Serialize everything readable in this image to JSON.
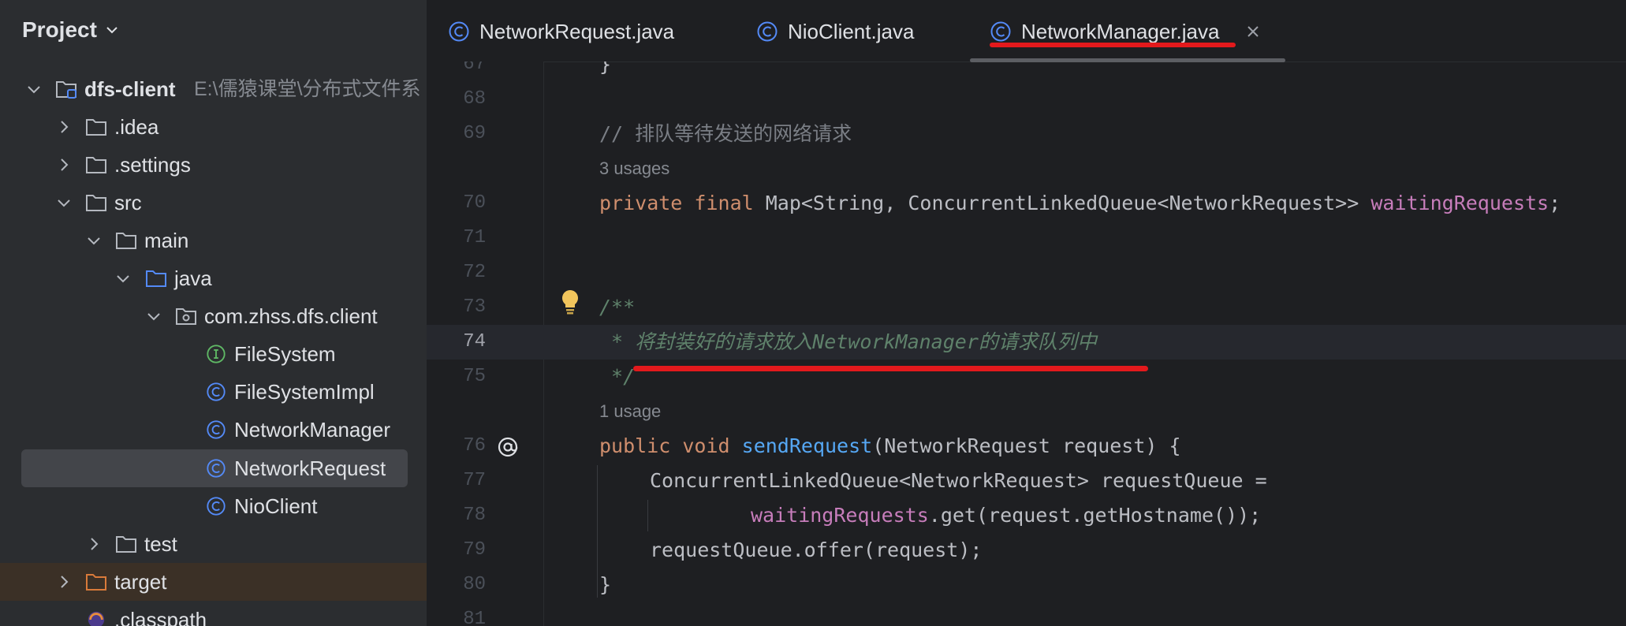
{
  "sidebar": {
    "title": "Project",
    "tree": [
      {
        "label": "dfs-client",
        "path": "E:\\儒猿课堂\\分布式文件系",
        "icon": "module-folder-icon",
        "expanded": true
      },
      {
        "label": ".idea",
        "icon": "folder-icon",
        "expanded": false
      },
      {
        "label": ".settings",
        "icon": "folder-icon",
        "expanded": false
      },
      {
        "label": "src",
        "icon": "folder-icon",
        "expanded": true
      },
      {
        "label": "main",
        "icon": "folder-icon",
        "expanded": true
      },
      {
        "label": "java",
        "icon": "source-folder-icon",
        "expanded": true
      },
      {
        "label": "com.zhss.dfs.client",
        "icon": "package-icon",
        "expanded": true
      },
      {
        "label": "FileSystem",
        "icon": "interface-icon"
      },
      {
        "label": "FileSystemImpl",
        "icon": "class-icon"
      },
      {
        "label": "NetworkManager",
        "icon": "class-icon"
      },
      {
        "label": "NetworkRequest",
        "icon": "class-icon",
        "selected": true
      },
      {
        "label": "NioClient",
        "icon": "class-icon"
      },
      {
        "label": "test",
        "icon": "folder-icon",
        "expanded": false
      },
      {
        "label": "target",
        "icon": "excluded-folder-icon",
        "expanded": false
      },
      {
        "label": ".classpath",
        "icon": "eclipse-file-icon"
      }
    ]
  },
  "tabs": [
    {
      "label": "NetworkRequest.java",
      "icon": "class-icon",
      "active": false
    },
    {
      "label": "NioClient.java",
      "icon": "class-icon",
      "active": false
    },
    {
      "label": "NetworkManager.java",
      "icon": "class-icon",
      "active": true
    }
  ],
  "editor": {
    "current_line": "74",
    "lines": [
      {
        "num": "67",
        "text": "}"
      },
      {
        "num": "68",
        "text": ""
      },
      {
        "num": "69",
        "text": "// 排队等待发送的网络请求"
      },
      {
        "hint": "3 usages"
      },
      {
        "num": "70",
        "kw": "private final",
        "plain1": " Map<String, ConcurrentLinkedQueue<NetworkRequest>> ",
        "field": "waitingRequests",
        "plain2": ";"
      },
      {
        "num": "71",
        "text": ""
      },
      {
        "num": "72",
        "text": ""
      },
      {
        "num": "73",
        "text": "/**"
      },
      {
        "num": "74",
        "text": " * 将封装好的请求放入NetworkManager的请求队列中"
      },
      {
        "num": "75",
        "text": " */"
      },
      {
        "hint": "1 usage"
      },
      {
        "num": "76",
        "kw": "public void",
        "fn": "sendRequest",
        "plain": "(NetworkRequest request) {"
      },
      {
        "num": "77",
        "text": "ConcurrentLinkedQueue<NetworkRequest> requestQueue ="
      },
      {
        "num": "78",
        "field": "waitingRequests",
        "plain": ".get(request.getHostname());"
      },
      {
        "num": "79",
        "text": "requestQueue.offer(request);"
      },
      {
        "num": "80",
        "text": "}"
      },
      {
        "num": "81",
        "text": ""
      }
    ]
  },
  "colors": {
    "keyword": "#cf8e6d",
    "field": "#c77dbb",
    "method": "#56a8f5",
    "doc_comment": "#5f826b",
    "annotation_red": "#e3191c"
  }
}
